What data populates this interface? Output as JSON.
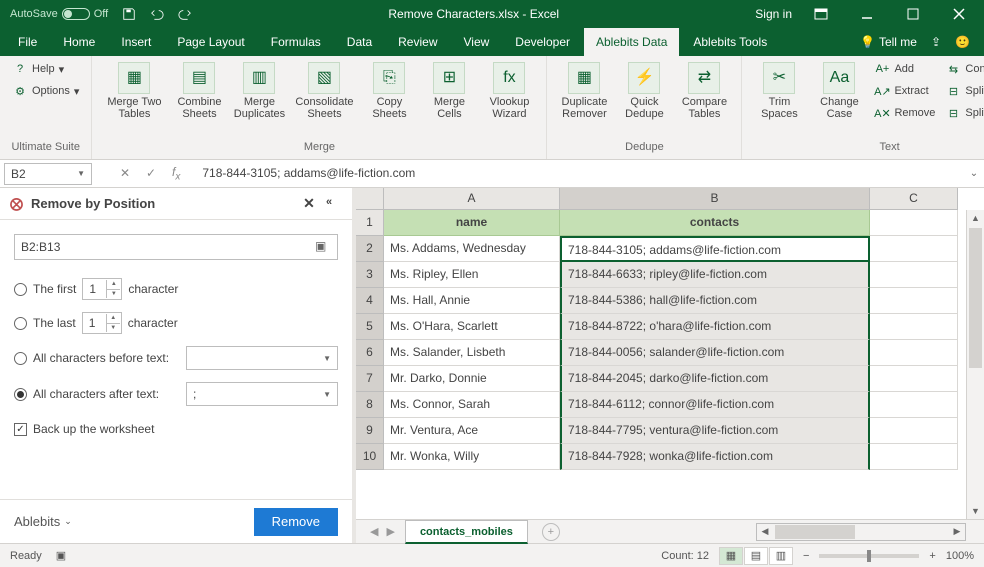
{
  "title": "Remove Characters.xlsx - Excel",
  "autosave_label": "AutoSave",
  "autosave_state": "Off",
  "signin": "Sign in",
  "tabs": [
    "File",
    "Home",
    "Insert",
    "Page Layout",
    "Formulas",
    "Data",
    "Review",
    "View",
    "Developer",
    "Ablebits Data",
    "Ablebits Tools"
  ],
  "tellme": "Tell me",
  "ribbon": {
    "group1_label": "Ultimate Suite",
    "help": "Help",
    "options": "Options",
    "group2_label": "Merge",
    "merge_two_tables": "Merge Two Tables",
    "combine_sheets": "Combine Sheets",
    "merge_duplicates": "Merge Duplicates",
    "consolidate_sheets": "Consolidate Sheets",
    "copy_sheets": "Copy Sheets",
    "merge_cells": "Merge Cells",
    "vlookup_wizard": "Vlookup Wizard",
    "group3_label": "Dedupe",
    "duplicate_remover": "Duplicate Remover",
    "quick_dedupe": "Quick Dedupe",
    "compare_tables": "Compare Tables",
    "group4_label": "Text",
    "trim_spaces": "Trim Spaces",
    "change_case": "Change Case",
    "add": "Add",
    "extract": "Extract",
    "remove": "Remove",
    "convert": "Convert",
    "split_text": "Split Text",
    "split_names": "Split Names"
  },
  "namebox": "B2",
  "formula": "718-844-3105; addams@life-fiction.com",
  "pane": {
    "title": "Remove by Position",
    "range": "B2:B13",
    "opt_first": "The first",
    "opt_last": "The last",
    "spin_val": "1",
    "char_label": "character",
    "opt_before": "All characters before text:",
    "opt_after": "All characters after text:",
    "after_value": ";",
    "backup": "Back up the worksheet",
    "brand": "Ablebits",
    "btn": "Remove"
  },
  "sheet": {
    "columns": [
      "A",
      "B",
      "C"
    ],
    "header_row": {
      "A": "name",
      "B": "contacts"
    },
    "rows": [
      {
        "n": 2,
        "A": "Ms. Addams, Wednesday",
        "B": "718-844-3105; addams@life-fiction.com"
      },
      {
        "n": 3,
        "A": "Ms. Ripley, Ellen",
        "B": "718-844-6633; ripley@life-fiction.com"
      },
      {
        "n": 4,
        "A": "Ms. Hall, Annie",
        "B": "718-844-5386; hall@life-fiction.com"
      },
      {
        "n": 5,
        "A": "Ms. O'Hara, Scarlett",
        "B": "718-844-8722; o'hara@life-fiction.com"
      },
      {
        "n": 6,
        "A": "Ms. Salander, Lisbeth",
        "B": "718-844-0056; salander@life-fiction.com"
      },
      {
        "n": 7,
        "A": "Mr. Darko, Donnie",
        "B": "718-844-2045; darko@life-fiction.com"
      },
      {
        "n": 8,
        "A": "Ms. Connor, Sarah",
        "B": "718-844-6112; connor@life-fiction.com"
      },
      {
        "n": 9,
        "A": "Mr. Ventura, Ace",
        "B": "718-844-7795; ventura@life-fiction.com"
      },
      {
        "n": 10,
        "A": "Mr. Wonka, Willy",
        "B": "718-844-7928; wonka@life-fiction.com"
      }
    ],
    "tab_name": "contacts_mobiles"
  },
  "status": {
    "ready": "Ready",
    "count": "Count: 12",
    "zoom": "100%"
  }
}
